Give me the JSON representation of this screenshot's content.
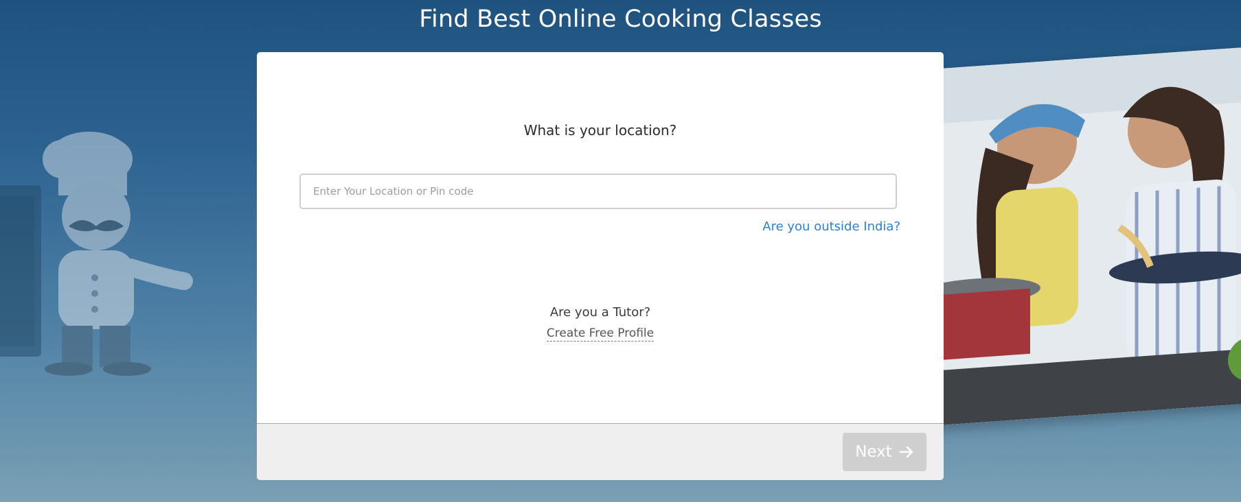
{
  "page": {
    "title": "Find Best Online Cooking Classes"
  },
  "form": {
    "question": "What is your location?",
    "location_placeholder": "Enter Your Location or Pin code",
    "location_value": "",
    "outside_india_link": "Are you outside India?",
    "tutor_question": "Are you a Tutor?",
    "create_profile_link": "Create Free Profile"
  },
  "footer": {
    "next_label": "Next",
    "next_icon": "arrow-right-icon"
  },
  "decorations": {
    "left_illustration": "chef-illustration",
    "right_image": "cooking-photo"
  },
  "colors": {
    "background_top": "#1f527f",
    "background_bottom": "#7aa0b4",
    "link": "#2b7fe0",
    "button_disabled": "#cfcfcf"
  }
}
